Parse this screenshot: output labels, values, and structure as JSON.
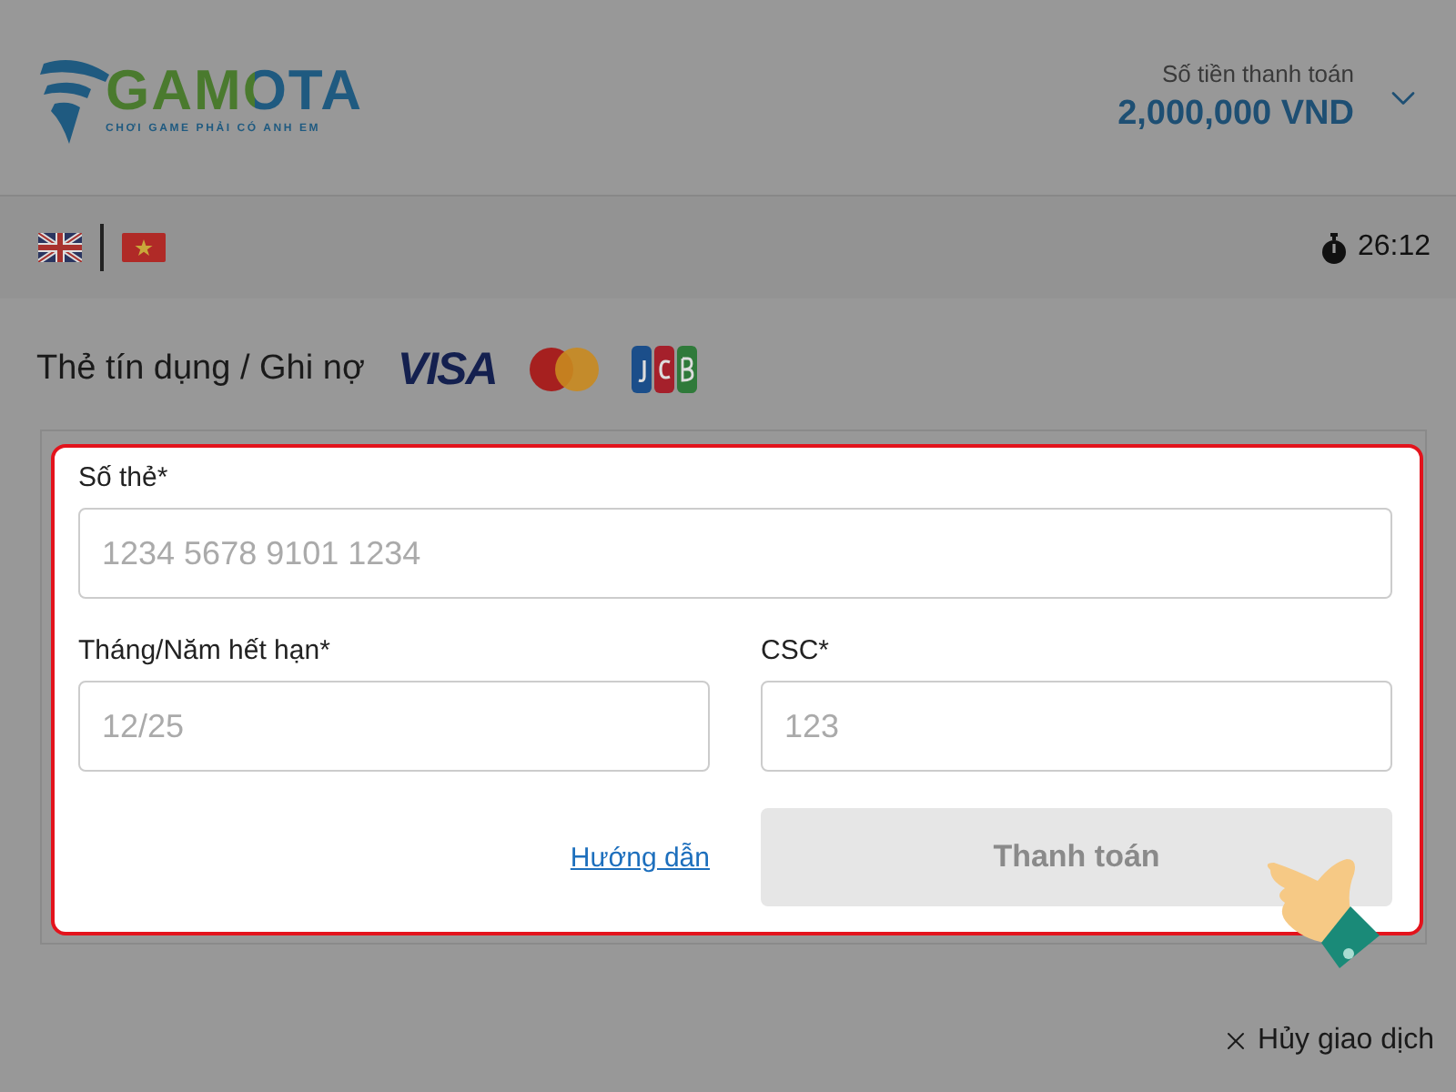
{
  "header": {
    "logo_text": "GAMOTA",
    "tagline": "CHƠI GAME PHẢI CÓ ANH EM",
    "amount_label": "Số tiền thanh toán",
    "amount": "2,000,000 VND"
  },
  "languages": [
    {
      "kind": "uk"
    },
    {
      "kind": "vn"
    }
  ],
  "timer": "26:12",
  "method": {
    "title": "Thẻ tín dụng / Ghi nợ",
    "brands": [
      {
        "kind": "visa",
        "text": "VISA"
      },
      {
        "kind": "mastercard"
      },
      {
        "kind": "jcb"
      }
    ]
  },
  "form": {
    "card_number": {
      "label": "Số thẻ*",
      "placeholder": "1234 5678 9101 1234"
    },
    "expiry": {
      "label": "Tháng/Năm hết hạn*",
      "placeholder": "12/25"
    },
    "csc": {
      "label": "CSC*",
      "placeholder": "123"
    },
    "guide_link": "Hướng dẫn",
    "pay_button": {
      "label": "Thanh toán",
      "disabled": true
    }
  },
  "cancel": "Hủy giao dịch"
}
